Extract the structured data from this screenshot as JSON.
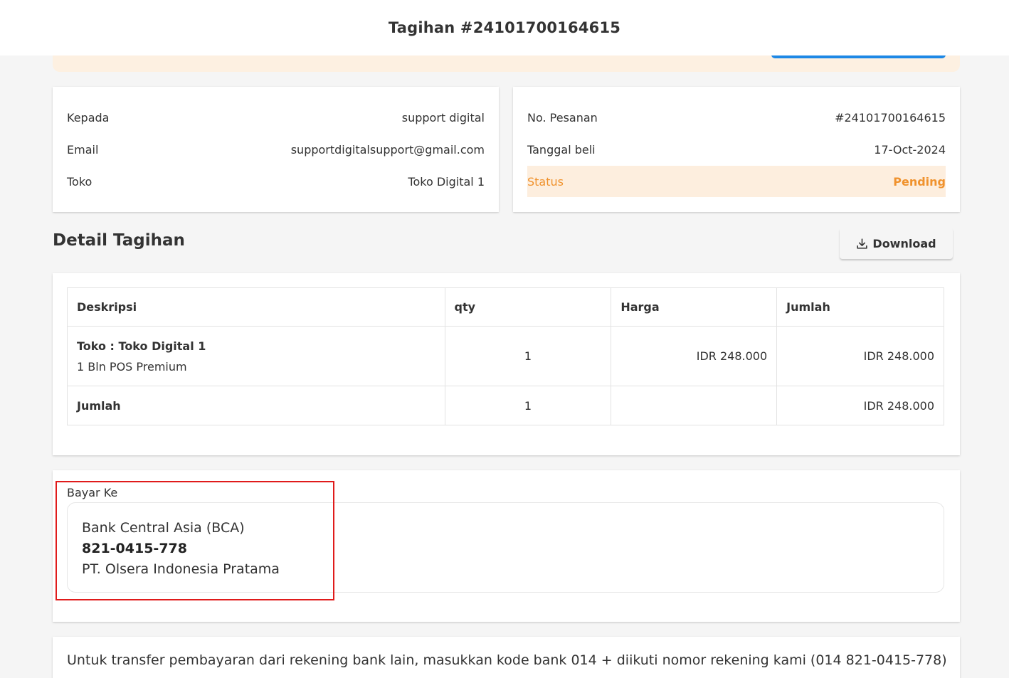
{
  "header": {
    "title": "Tagihan #24101700164615"
  },
  "customer": {
    "rows": [
      {
        "label": "Kepada",
        "value": "support digital"
      },
      {
        "label": "Email",
        "value": "supportdigitalsupport@gmail.com"
      },
      {
        "label": "Toko",
        "value": "Toko Digital 1"
      }
    ]
  },
  "order": {
    "rows": [
      {
        "label": "No. Pesanan",
        "value": "#24101700164615"
      },
      {
        "label": "Tanggal beli",
        "value": "17-Oct-2024"
      },
      {
        "label": "Status",
        "value": "Pending"
      }
    ]
  },
  "details": {
    "title": "Detail Tagihan",
    "download_label": "Download",
    "columns": [
      "Deskripsi",
      "qty",
      "Harga",
      "Jumlah"
    ],
    "item": {
      "store": "Toko : Toko Digital 1",
      "product": "1 Bln POS Premium",
      "qty": "1",
      "price": "IDR 248.000",
      "amount": "IDR 248.000"
    },
    "total": {
      "label": "Jumlah",
      "qty": "1",
      "price": "",
      "amount": "IDR 248.000"
    }
  },
  "payto": {
    "label": "Bayar Ke",
    "bank": "Bank Central Asia (BCA)",
    "account_number": "821-0415-778",
    "account_name": "PT. Olsera Indonesia Pratama"
  },
  "transfer_note": "Untuk transfer pembayaran dari rekening bank lain, masukkan kode bank 014 + diikuti nomor rekening kami (014 821-0415-778)",
  "colors": {
    "status": "#f0922d",
    "status_bg": "#fdeede",
    "banner_bg": "#fdf0e1",
    "accent": "#1e88e5",
    "highlight": "#e01b1b"
  },
  "icons": {
    "download": "download-icon"
  }
}
